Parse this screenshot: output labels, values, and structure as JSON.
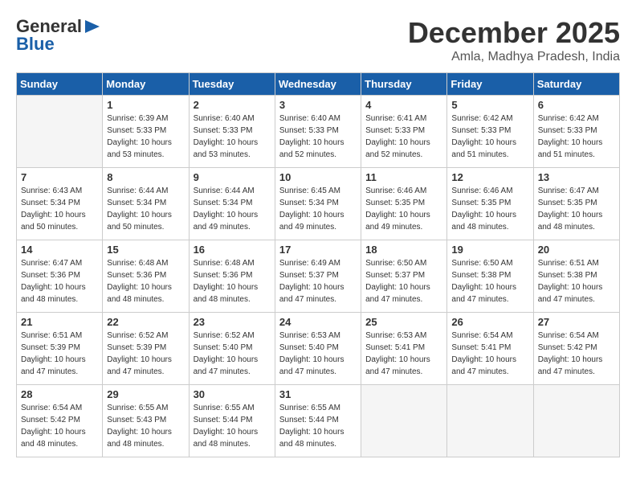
{
  "header": {
    "logo_general": "General",
    "logo_blue": "Blue",
    "month": "December 2025",
    "location": "Amla, Madhya Pradesh, India"
  },
  "days_of_week": [
    "Sunday",
    "Monday",
    "Tuesday",
    "Wednesday",
    "Thursday",
    "Friday",
    "Saturday"
  ],
  "weeks": [
    [
      {
        "day": "",
        "sunrise": "",
        "sunset": "",
        "daylight": ""
      },
      {
        "day": "1",
        "sunrise": "Sunrise: 6:39 AM",
        "sunset": "Sunset: 5:33 PM",
        "daylight": "Daylight: 10 hours and 53 minutes."
      },
      {
        "day": "2",
        "sunrise": "Sunrise: 6:40 AM",
        "sunset": "Sunset: 5:33 PM",
        "daylight": "Daylight: 10 hours and 53 minutes."
      },
      {
        "day": "3",
        "sunrise": "Sunrise: 6:40 AM",
        "sunset": "Sunset: 5:33 PM",
        "daylight": "Daylight: 10 hours and 52 minutes."
      },
      {
        "day": "4",
        "sunrise": "Sunrise: 6:41 AM",
        "sunset": "Sunset: 5:33 PM",
        "daylight": "Daylight: 10 hours and 52 minutes."
      },
      {
        "day": "5",
        "sunrise": "Sunrise: 6:42 AM",
        "sunset": "Sunset: 5:33 PM",
        "daylight": "Daylight: 10 hours and 51 minutes."
      },
      {
        "day": "6",
        "sunrise": "Sunrise: 6:42 AM",
        "sunset": "Sunset: 5:33 PM",
        "daylight": "Daylight: 10 hours and 51 minutes."
      }
    ],
    [
      {
        "day": "7",
        "sunrise": "Sunrise: 6:43 AM",
        "sunset": "Sunset: 5:34 PM",
        "daylight": "Daylight: 10 hours and 50 minutes."
      },
      {
        "day": "8",
        "sunrise": "Sunrise: 6:44 AM",
        "sunset": "Sunset: 5:34 PM",
        "daylight": "Daylight: 10 hours and 50 minutes."
      },
      {
        "day": "9",
        "sunrise": "Sunrise: 6:44 AM",
        "sunset": "Sunset: 5:34 PM",
        "daylight": "Daylight: 10 hours and 49 minutes."
      },
      {
        "day": "10",
        "sunrise": "Sunrise: 6:45 AM",
        "sunset": "Sunset: 5:34 PM",
        "daylight": "Daylight: 10 hours and 49 minutes."
      },
      {
        "day": "11",
        "sunrise": "Sunrise: 6:46 AM",
        "sunset": "Sunset: 5:35 PM",
        "daylight": "Daylight: 10 hours and 49 minutes."
      },
      {
        "day": "12",
        "sunrise": "Sunrise: 6:46 AM",
        "sunset": "Sunset: 5:35 PM",
        "daylight": "Daylight: 10 hours and 48 minutes."
      },
      {
        "day": "13",
        "sunrise": "Sunrise: 6:47 AM",
        "sunset": "Sunset: 5:35 PM",
        "daylight": "Daylight: 10 hours and 48 minutes."
      }
    ],
    [
      {
        "day": "14",
        "sunrise": "Sunrise: 6:47 AM",
        "sunset": "Sunset: 5:36 PM",
        "daylight": "Daylight: 10 hours and 48 minutes."
      },
      {
        "day": "15",
        "sunrise": "Sunrise: 6:48 AM",
        "sunset": "Sunset: 5:36 PM",
        "daylight": "Daylight: 10 hours and 48 minutes."
      },
      {
        "day": "16",
        "sunrise": "Sunrise: 6:48 AM",
        "sunset": "Sunset: 5:36 PM",
        "daylight": "Daylight: 10 hours and 48 minutes."
      },
      {
        "day": "17",
        "sunrise": "Sunrise: 6:49 AM",
        "sunset": "Sunset: 5:37 PM",
        "daylight": "Daylight: 10 hours and 47 minutes."
      },
      {
        "day": "18",
        "sunrise": "Sunrise: 6:50 AM",
        "sunset": "Sunset: 5:37 PM",
        "daylight": "Daylight: 10 hours and 47 minutes."
      },
      {
        "day": "19",
        "sunrise": "Sunrise: 6:50 AM",
        "sunset": "Sunset: 5:38 PM",
        "daylight": "Daylight: 10 hours and 47 minutes."
      },
      {
        "day": "20",
        "sunrise": "Sunrise: 6:51 AM",
        "sunset": "Sunset: 5:38 PM",
        "daylight": "Daylight: 10 hours and 47 minutes."
      }
    ],
    [
      {
        "day": "21",
        "sunrise": "Sunrise: 6:51 AM",
        "sunset": "Sunset: 5:39 PM",
        "daylight": "Daylight: 10 hours and 47 minutes."
      },
      {
        "day": "22",
        "sunrise": "Sunrise: 6:52 AM",
        "sunset": "Sunset: 5:39 PM",
        "daylight": "Daylight: 10 hours and 47 minutes."
      },
      {
        "day": "23",
        "sunrise": "Sunrise: 6:52 AM",
        "sunset": "Sunset: 5:40 PM",
        "daylight": "Daylight: 10 hours and 47 minutes."
      },
      {
        "day": "24",
        "sunrise": "Sunrise: 6:53 AM",
        "sunset": "Sunset: 5:40 PM",
        "daylight": "Daylight: 10 hours and 47 minutes."
      },
      {
        "day": "25",
        "sunrise": "Sunrise: 6:53 AM",
        "sunset": "Sunset: 5:41 PM",
        "daylight": "Daylight: 10 hours and 47 minutes."
      },
      {
        "day": "26",
        "sunrise": "Sunrise: 6:54 AM",
        "sunset": "Sunset: 5:41 PM",
        "daylight": "Daylight: 10 hours and 47 minutes."
      },
      {
        "day": "27",
        "sunrise": "Sunrise: 6:54 AM",
        "sunset": "Sunset: 5:42 PM",
        "daylight": "Daylight: 10 hours and 47 minutes."
      }
    ],
    [
      {
        "day": "28",
        "sunrise": "Sunrise: 6:54 AM",
        "sunset": "Sunset: 5:42 PM",
        "daylight": "Daylight: 10 hours and 48 minutes."
      },
      {
        "day": "29",
        "sunrise": "Sunrise: 6:55 AM",
        "sunset": "Sunset: 5:43 PM",
        "daylight": "Daylight: 10 hours and 48 minutes."
      },
      {
        "day": "30",
        "sunrise": "Sunrise: 6:55 AM",
        "sunset": "Sunset: 5:44 PM",
        "daylight": "Daylight: 10 hours and 48 minutes."
      },
      {
        "day": "31",
        "sunrise": "Sunrise: 6:55 AM",
        "sunset": "Sunset: 5:44 PM",
        "daylight": "Daylight: 10 hours and 48 minutes."
      },
      {
        "day": "",
        "sunrise": "",
        "sunset": "",
        "daylight": ""
      },
      {
        "day": "",
        "sunrise": "",
        "sunset": "",
        "daylight": ""
      },
      {
        "day": "",
        "sunrise": "",
        "sunset": "",
        "daylight": ""
      }
    ]
  ]
}
